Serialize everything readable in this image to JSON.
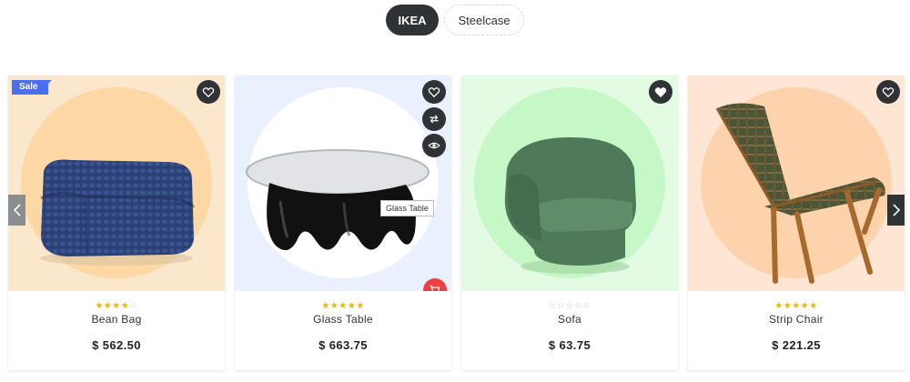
{
  "tabs": [
    {
      "label": "IKEA",
      "active": true
    },
    {
      "label": "Steelcase",
      "active": false
    }
  ],
  "products": [
    {
      "name": "Bean Bag",
      "price": "$ 562.50",
      "rating": 4,
      "badge": "Sale",
      "favorited": false,
      "background": "#fbe8cc",
      "circle": "#fdd8a5"
    },
    {
      "name": "Glass Table",
      "price": "$ 663.75",
      "rating": 5,
      "favorited": false,
      "tooltip": "Glass Table",
      "background": "#e9f1ff",
      "circle": "#ffffff"
    },
    {
      "name": "Sofa",
      "price": "$ 63.75",
      "rating": 0,
      "favorited": true,
      "background": "#e3fbe3",
      "circle": "#c6f7c6"
    },
    {
      "name": "Strip Chair",
      "price": "$ 221.25",
      "rating": 5,
      "favorited": false,
      "background": "#fde6d3",
      "circle": "#fdd3ad"
    }
  ],
  "colors": {
    "accent": "#2f3236",
    "star": "#f4b400",
    "cart": "#ef3e3e",
    "sale": "#4a6ff0"
  },
  "icons": {
    "wishlist": "heart-icon",
    "compare": "compare-arrows-icon",
    "quickview": "eye-icon",
    "cart": "cart-icon",
    "prev": "chevron-left-icon",
    "next": "chevron-right-icon"
  }
}
